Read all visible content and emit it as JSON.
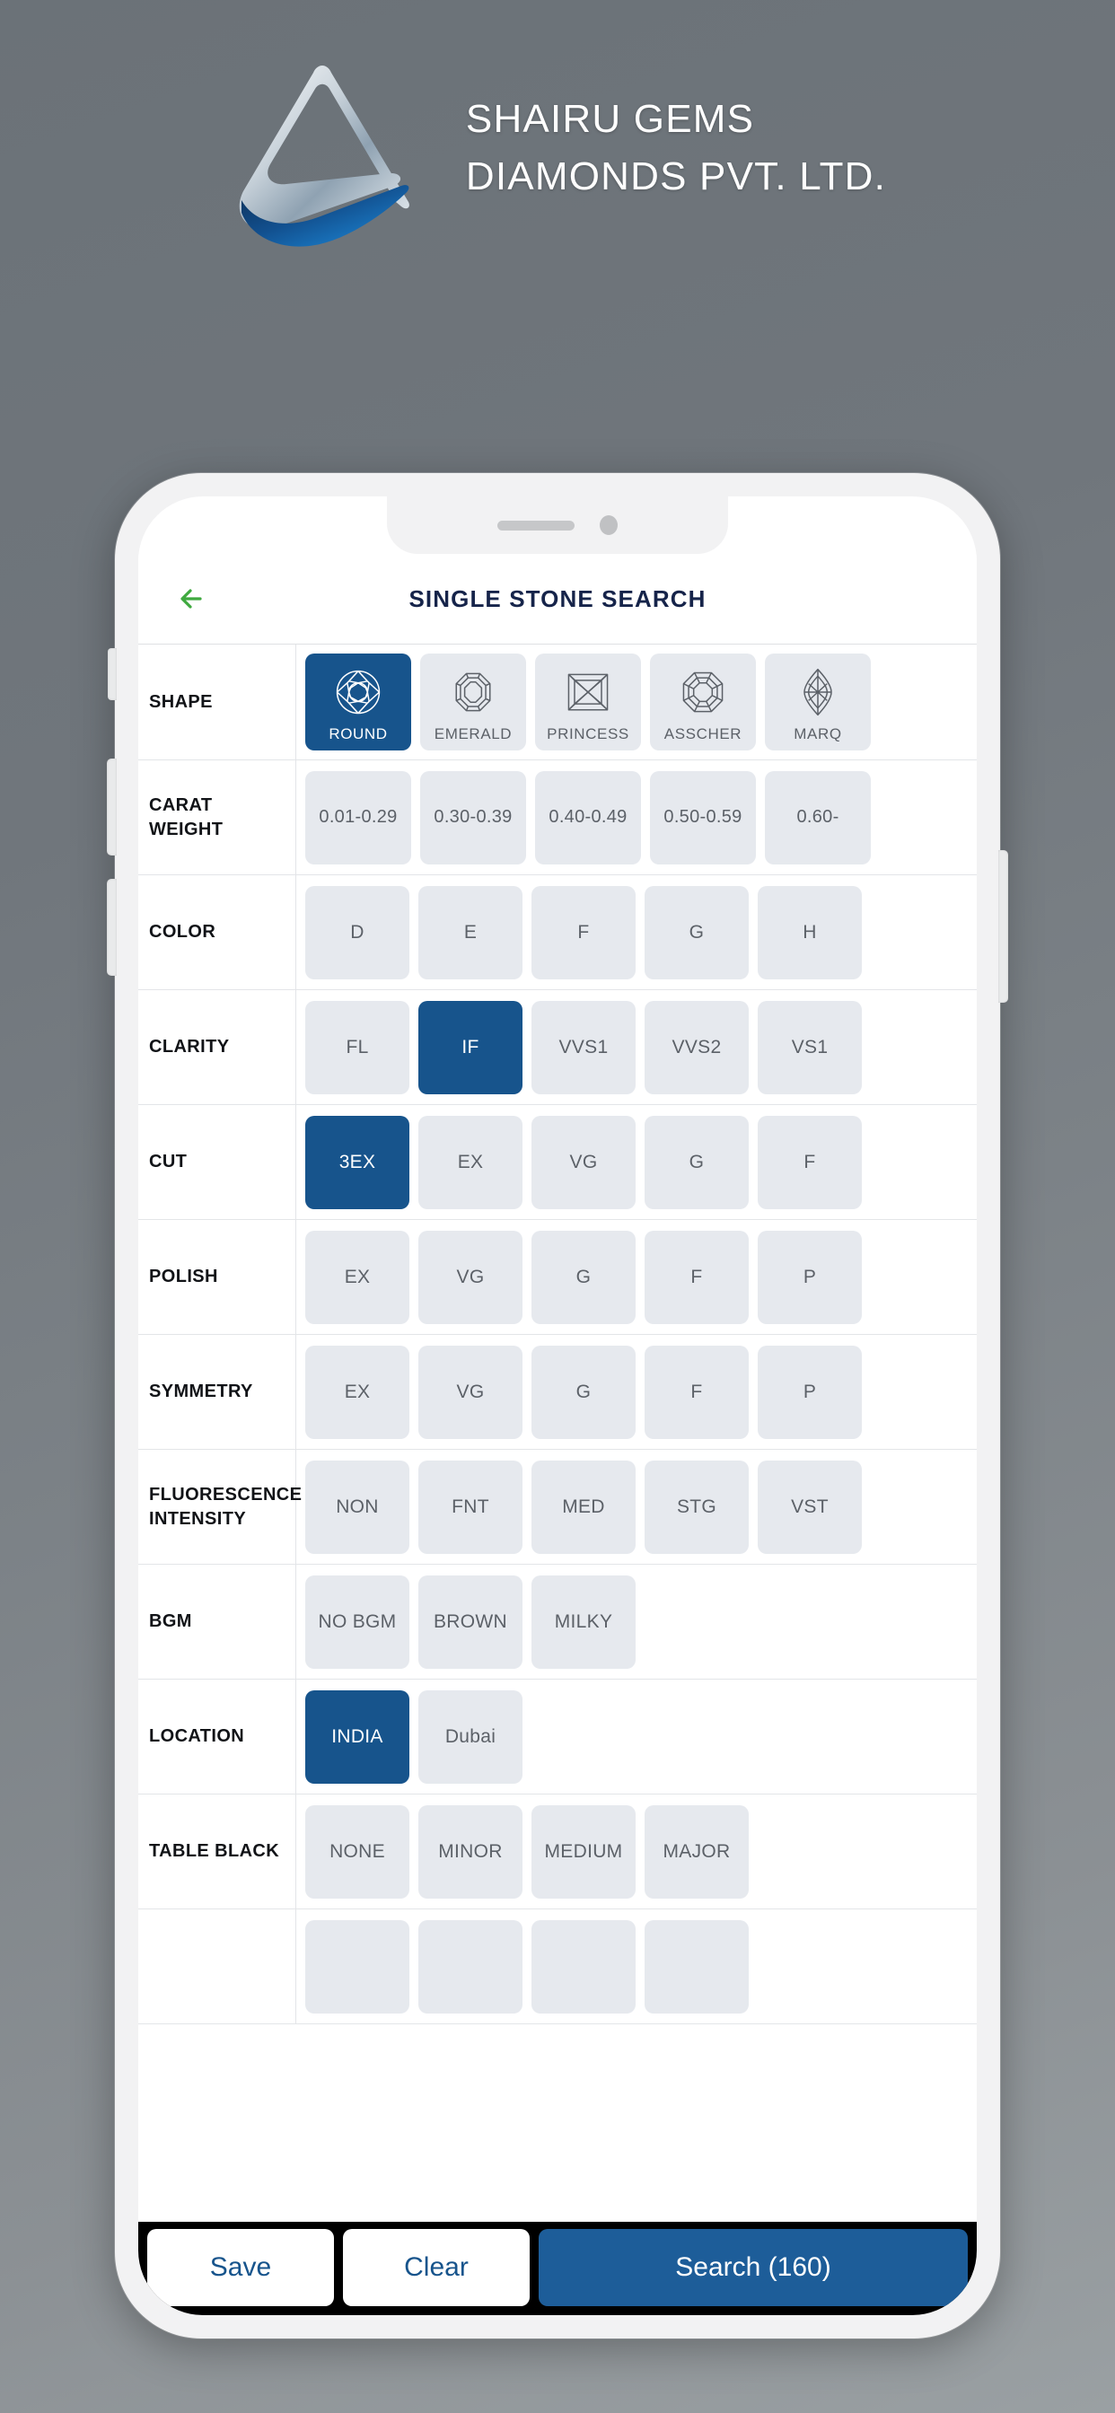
{
  "brand": {
    "line1": "SHAIRU GEMS",
    "line2": "DIAMONDS PVT. LTD.",
    "logo_icon": "shairu-triangle-wave-logo"
  },
  "colors": {
    "selected_blue": "#17548c",
    "search_blue": "#1d5d99",
    "chip_grey": "#e6e9ee",
    "title_navy": "#16244a",
    "back_arrow_green": "#3fa93f",
    "page_background": "#7c8287"
  },
  "phone": {
    "notch": {
      "speaker_icon": "speaker-slot",
      "camera_icon": "front-camera-dot"
    },
    "side_buttons": [
      "mute-switch",
      "volume-up-button",
      "volume-down-button",
      "power-button"
    ]
  },
  "app": {
    "header": {
      "back_icon": "back-arrow-icon",
      "title": "SINGLE STONE SEARCH"
    },
    "rows": [
      {
        "label": "SHAPE",
        "kind": "shape",
        "chips": [
          {
            "label": "ROUND",
            "icon": "round-diamond-icon",
            "selected": true
          },
          {
            "label": "EMERALD",
            "icon": "emerald-diamond-icon",
            "selected": false
          },
          {
            "label": "PRINCESS",
            "icon": "princess-diamond-icon",
            "selected": false
          },
          {
            "label": "ASSCHER",
            "icon": "asscher-diamond-icon",
            "selected": false
          },
          {
            "label": "MARQ",
            "icon": "marquise-diamond-icon",
            "selected": false
          }
        ]
      },
      {
        "label": "CARAT WEIGHT",
        "kind": "text",
        "chips": [
          {
            "label": "0.01-0.29",
            "selected": false
          },
          {
            "label": "0.30-0.39",
            "selected": false
          },
          {
            "label": "0.40-0.49",
            "selected": false
          },
          {
            "label": "0.50-0.59",
            "selected": false
          },
          {
            "label": "0.60-",
            "selected": false
          }
        ]
      },
      {
        "label": "COLOR",
        "kind": "text",
        "chips": [
          {
            "label": "D",
            "selected": false
          },
          {
            "label": "E",
            "selected": false
          },
          {
            "label": "F",
            "selected": false
          },
          {
            "label": "G",
            "selected": false
          },
          {
            "label": "H",
            "selected": false
          }
        ]
      },
      {
        "label": "CLARITY",
        "kind": "text",
        "chips": [
          {
            "label": "FL",
            "selected": false
          },
          {
            "label": "IF",
            "selected": true
          },
          {
            "label": "VVS1",
            "selected": false
          },
          {
            "label": "VVS2",
            "selected": false
          },
          {
            "label": "VS1",
            "selected": false
          }
        ]
      },
      {
        "label": "CUT",
        "kind": "text",
        "chips": [
          {
            "label": "3EX",
            "selected": true
          },
          {
            "label": "EX",
            "selected": false
          },
          {
            "label": "VG",
            "selected": false
          },
          {
            "label": "G",
            "selected": false
          },
          {
            "label": "F",
            "selected": false
          }
        ]
      },
      {
        "label": "POLISH",
        "kind": "text",
        "chips": [
          {
            "label": "EX",
            "selected": false
          },
          {
            "label": "VG",
            "selected": false
          },
          {
            "label": "G",
            "selected": false
          },
          {
            "label": "F",
            "selected": false
          },
          {
            "label": "P",
            "selected": false
          }
        ]
      },
      {
        "label": "SYMMETRY",
        "kind": "text",
        "chips": [
          {
            "label": "EX",
            "selected": false
          },
          {
            "label": "VG",
            "selected": false
          },
          {
            "label": "G",
            "selected": false
          },
          {
            "label": "F",
            "selected": false
          },
          {
            "label": "P",
            "selected": false
          }
        ]
      },
      {
        "label": "FLUORESCENCE INTENSITY",
        "kind": "text",
        "chips": [
          {
            "label": "NON",
            "selected": false
          },
          {
            "label": "FNT",
            "selected": false
          },
          {
            "label": "MED",
            "selected": false
          },
          {
            "label": "STG",
            "selected": false
          },
          {
            "label": "VST",
            "selected": false
          }
        ]
      },
      {
        "label": "BGM",
        "kind": "text",
        "chips": [
          {
            "label": "NO BGM",
            "selected": false
          },
          {
            "label": "BROWN",
            "selected": false
          },
          {
            "label": "MILKY",
            "selected": false
          }
        ]
      },
      {
        "label": "LOCATION",
        "kind": "text",
        "chips": [
          {
            "label": "INDIA",
            "selected": true
          },
          {
            "label": "Dubai",
            "selected": false
          }
        ]
      },
      {
        "label": "TABLE BLACK",
        "kind": "text",
        "chips": [
          {
            "label": "NONE",
            "selected": false
          },
          {
            "label": "MINOR",
            "selected": false
          },
          {
            "label": "MEDIUM",
            "selected": false
          },
          {
            "label": "MAJOR",
            "selected": false
          }
        ]
      },
      {
        "label": "",
        "kind": "text",
        "chips": [
          {
            "label": "",
            "selected": false
          },
          {
            "label": "",
            "selected": false
          },
          {
            "label": "",
            "selected": false
          },
          {
            "label": "",
            "selected": false
          }
        ]
      }
    ],
    "actionbar": {
      "save_label": "Save",
      "clear_label": "Clear",
      "search_label": "Search (160)"
    }
  }
}
